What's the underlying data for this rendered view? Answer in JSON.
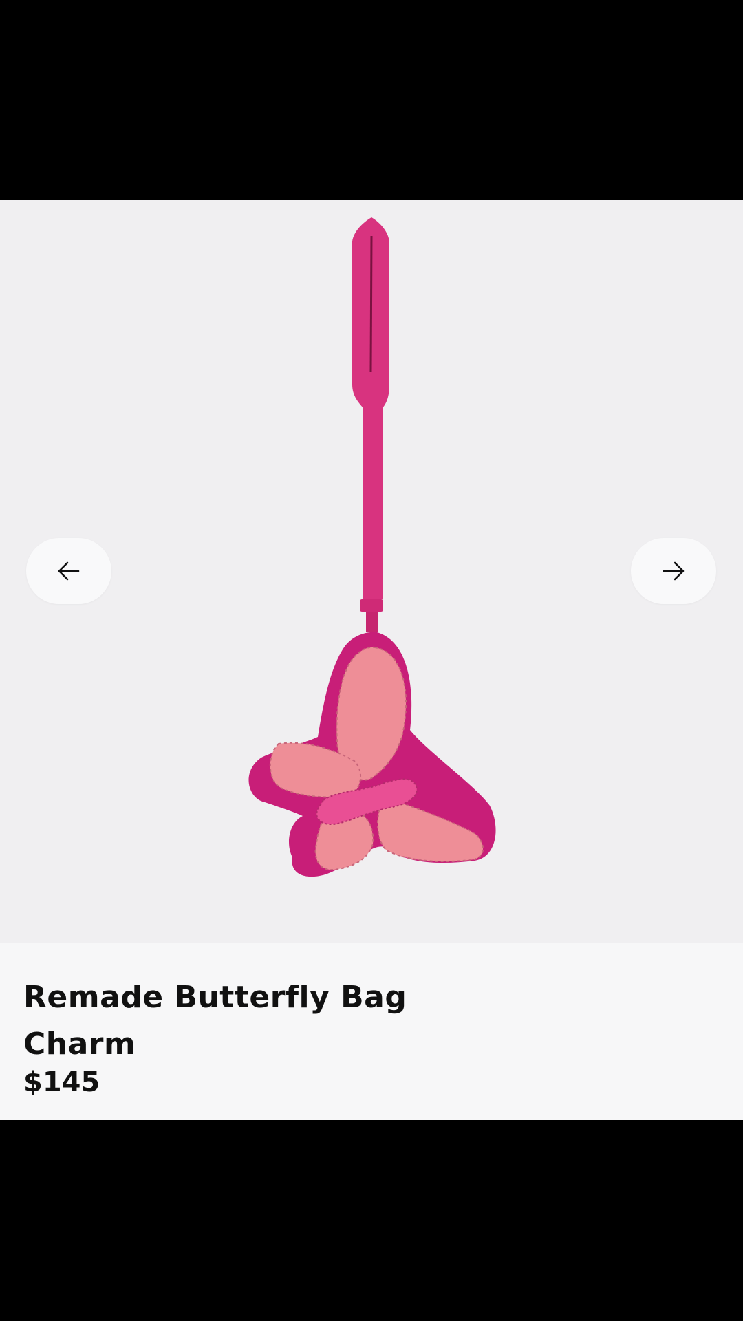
{
  "product": {
    "name": "Remade Butterfly Bag Charm",
    "price": "$145"
  },
  "carousel": {
    "prev_icon": "arrow-left-icon",
    "next_icon": "arrow-right-icon"
  },
  "colors": {
    "strap": "#d8337f",
    "wing_outer": "#c81e78",
    "wing_inner": "#ee8e97",
    "body": "#e94f94"
  }
}
